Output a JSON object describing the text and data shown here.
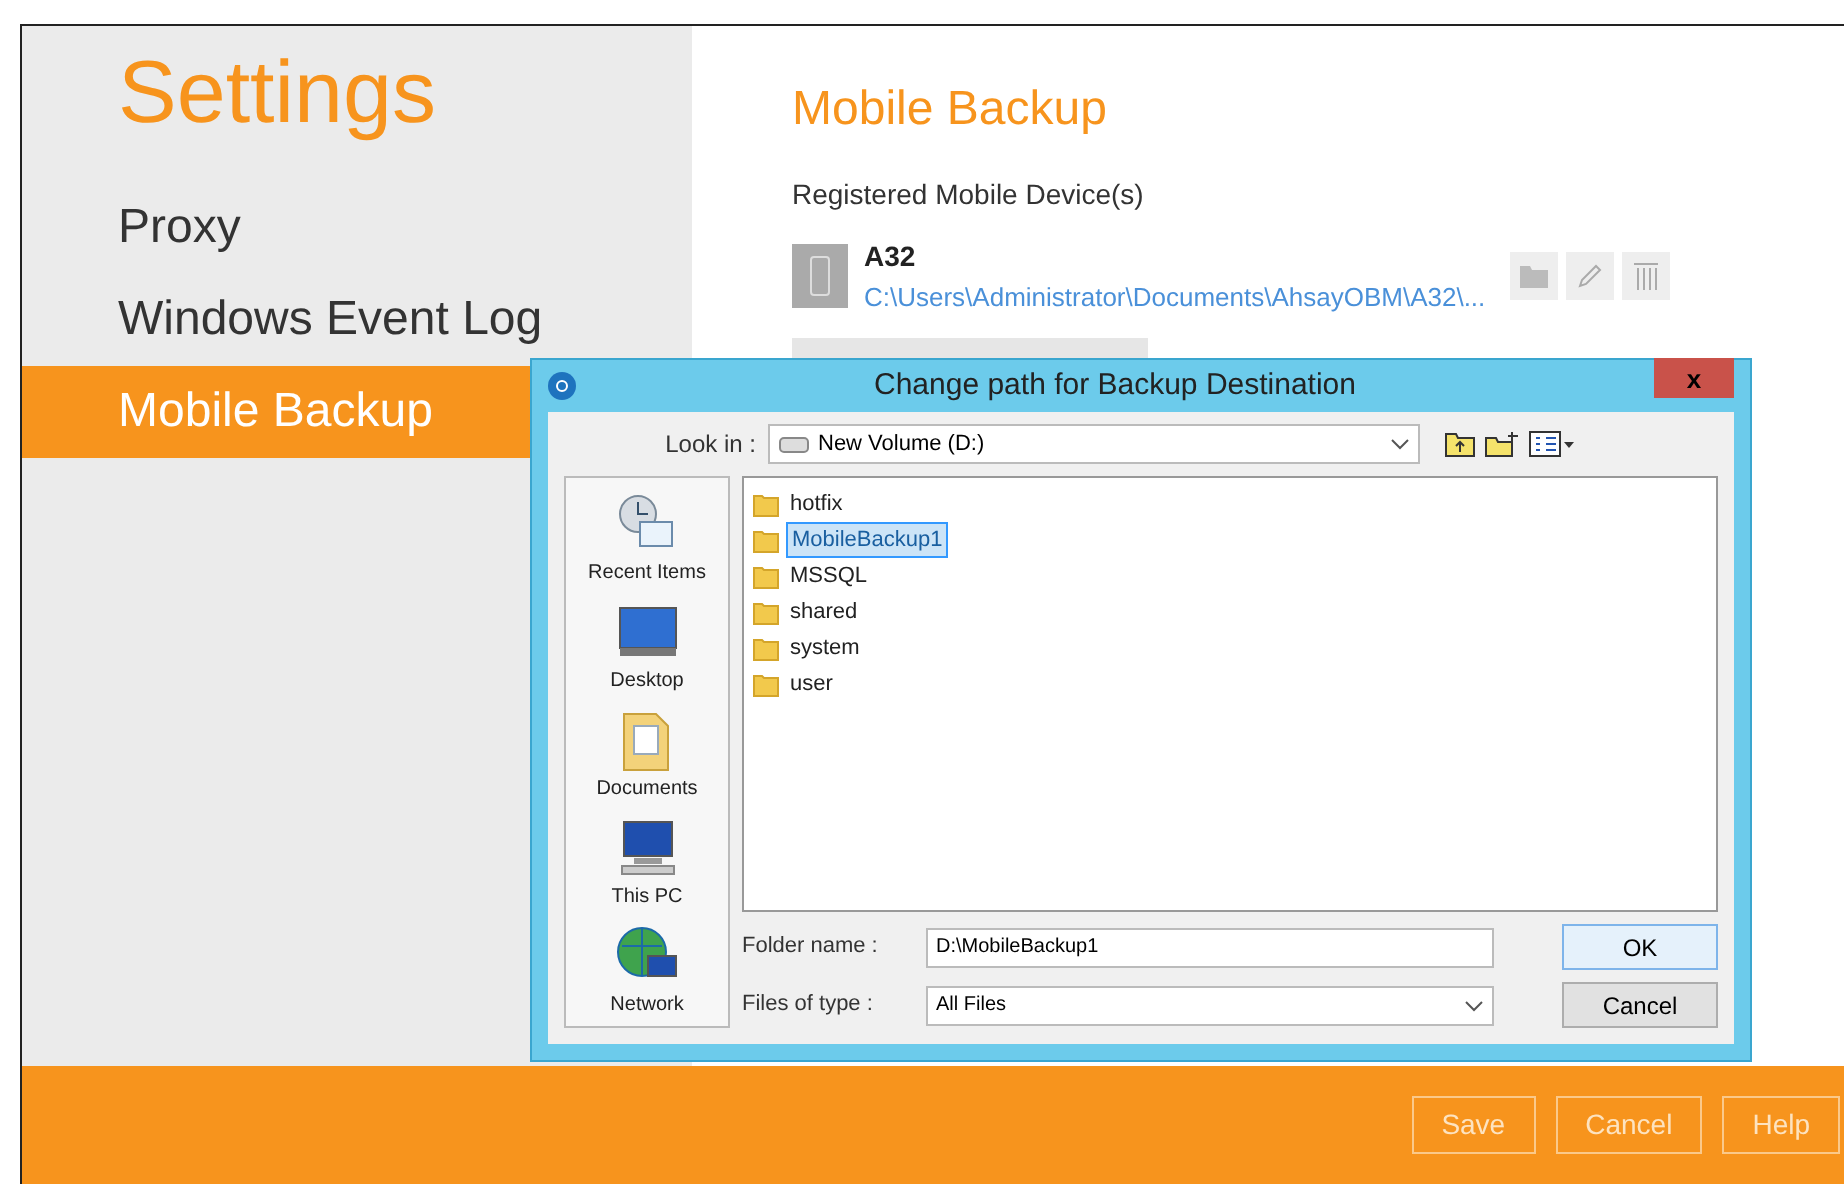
{
  "sidebar": {
    "title": "Settings",
    "items": [
      {
        "label": "Proxy",
        "selected": false
      },
      {
        "label": "Windows Event Log",
        "selected": false
      },
      {
        "label": "Mobile Backup",
        "selected": true
      }
    ]
  },
  "main": {
    "title": "Mobile Backup",
    "section_label": "Registered Mobile Device(s)",
    "device": {
      "name": "A32",
      "path": "C:\\Users\\Administrator\\Documents\\AhsayOBM\\A32\\..."
    }
  },
  "dialog": {
    "title": "Change path for Backup Destination",
    "look_in_label": "Look in :",
    "look_in_value": "New Volume (D:)",
    "places": [
      "Recent Items",
      "Desktop",
      "Documents",
      "This PC",
      "Network"
    ],
    "folders": [
      {
        "name": "hotfix",
        "selected": false
      },
      {
        "name": "MobileBackup1",
        "selected": true
      },
      {
        "name": "MSSQL",
        "selected": false
      },
      {
        "name": "shared",
        "selected": false
      },
      {
        "name": "system",
        "selected": false
      },
      {
        "name": "user",
        "selected": false
      }
    ],
    "folder_name_label": "Folder name :",
    "folder_name_value": "D:\\MobileBackup1",
    "files_of_type_label": "Files of type :",
    "files_of_type_value": "All Files",
    "ok": "OK",
    "cancel": "Cancel",
    "close": "x"
  },
  "footer": {
    "buttons": [
      "Save",
      "Cancel",
      "Help"
    ]
  }
}
